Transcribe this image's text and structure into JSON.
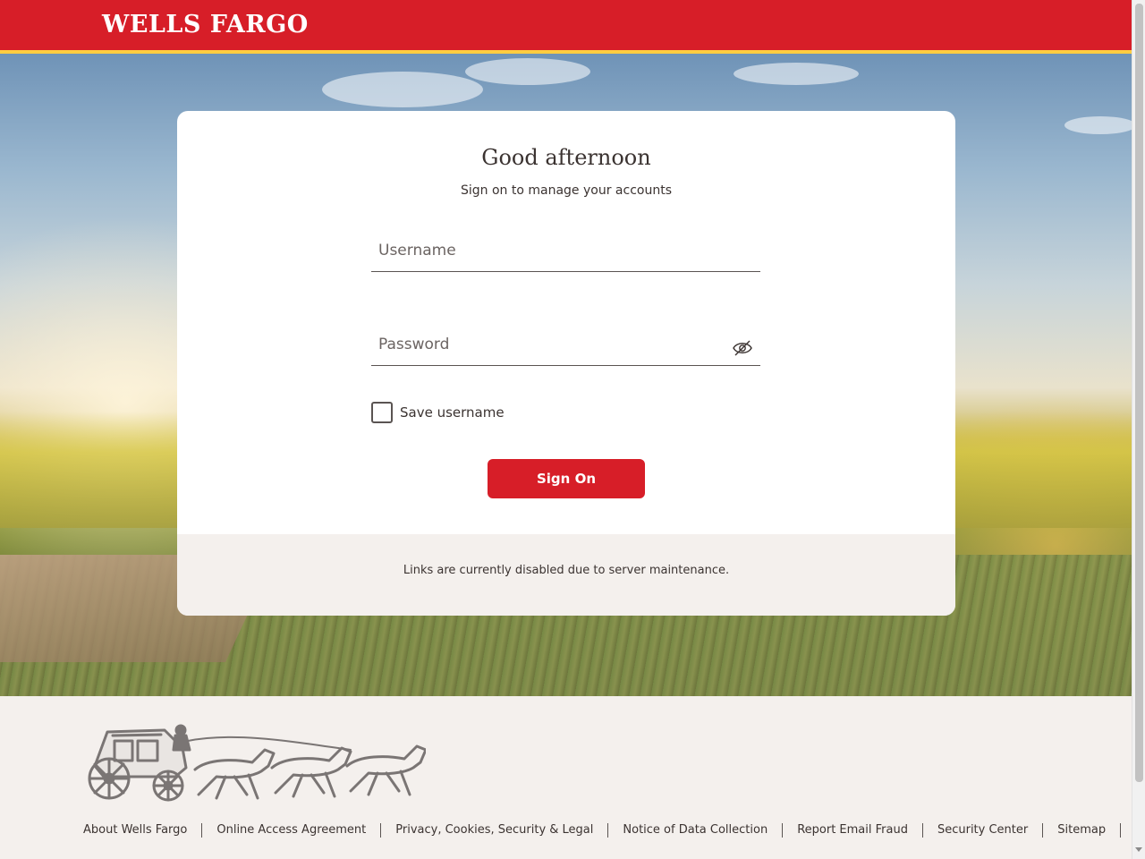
{
  "header": {
    "logo": "WELLS FARGO"
  },
  "card": {
    "greeting": "Good afternoon",
    "subtitle": "Sign on to manage your accounts",
    "username_placeholder": "Username",
    "password_placeholder": "Password",
    "save_username_label": "Save username",
    "sign_on_label": "Sign On",
    "maintenance_notice": "Links are currently disabled due to server maintenance."
  },
  "footer": {
    "links": [
      "About Wells Fargo",
      "Online Access Agreement",
      "Privacy, Cookies, Security & Legal",
      "Notice of Data Collection",
      "Report Email Fraud",
      "Security Center",
      "Sitemap"
    ]
  },
  "colors": {
    "brand_red": "#d71e28",
    "brand_gold": "#ffcd41",
    "text": "#3b3331",
    "footer_bg": "#f4f0ed"
  },
  "icons": {
    "password_toggle": "eye-slash-icon",
    "footer_logo": "stagecoach-logo"
  }
}
